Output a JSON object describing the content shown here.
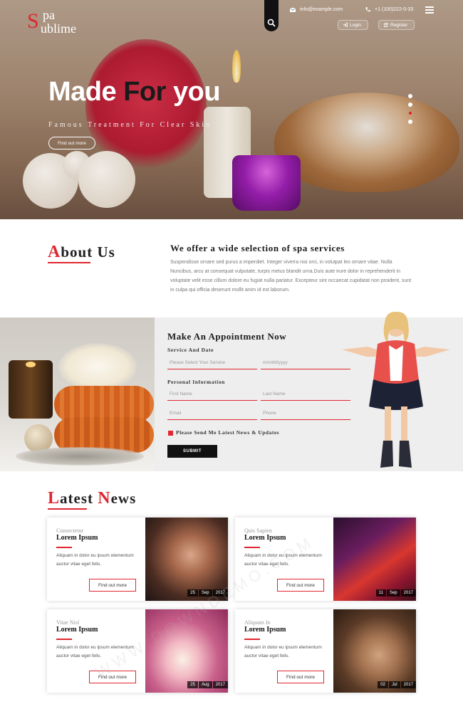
{
  "brand": {
    "logo_cap_s1": "S",
    "logo_line1": "pa",
    "logo_cap_s2": "S",
    "logo_line2": "ublime",
    "accent_color": "#e0262f"
  },
  "header": {
    "email": "info@example.com",
    "phone": "+1 (100)222-0-33",
    "login_label": "Login",
    "register_label": "Register",
    "search_icon": "search-icon",
    "menu_icon": "menu-icon"
  },
  "hero": {
    "title_part1": "Made ",
    "title_part2": "For",
    "title_part3": " you",
    "subtitle": "Famous Treatment For Clear Skin",
    "button_label": "Find out more",
    "slides_count": 4,
    "active_slide": 3
  },
  "about": {
    "title_first": "A",
    "title_rest": "bout Us",
    "heading": "We offer a wide selection of spa services",
    "text": "Suspendisse ornare sed purus a imperdiet. Integer viverra nisi orci, in volutpat leo ornare vitae. Nulla Nuncibus, arcu at consequat vulputate, turpis metus blandit urna.Duis aute irure dolor in reprehenderit in voluptate velit esse cillum dolore eu fugiat nulla pariatur. Excepteur sint occaecat cupidatat non proident, sunt in culpa qui officia deserunt mollit anim id est laborum."
  },
  "appointment": {
    "title": "Make An Appointment Now",
    "section1_label": "Service And Date",
    "service_placeholder": "Please Select Your Service",
    "date_placeholder": "mm/dd/yyyy",
    "section2_label": "Personal Information",
    "firstname_placeholder": "First Name",
    "lastname_placeholder": "Last Name",
    "email_placeholder": "Email",
    "phone_placeholder": "Phone",
    "newsletter_label": "Please Send Me Latest News & Updates",
    "submit_label": "SUBMIT"
  },
  "news": {
    "title_first": "L",
    "title_rest1": "atest ",
    "title_first2": "N",
    "title_rest2": "ews",
    "cards": [
      {
        "category": "Consectetur",
        "title": "Lorem Ipsum",
        "text": "Aliquam in dolor eu ipsum elementum auctor vitae eget felis.",
        "button": "Find out more",
        "day": "25",
        "month": "Sep",
        "year": "2017"
      },
      {
        "category": "Quis Sapien",
        "title": "Lorem Ipsum",
        "text": "Aliquam in dolor eu ipsum elementum auctor vitae eget felis.",
        "button": "Find out more",
        "day": "11",
        "month": "Sep",
        "year": "2017"
      },
      {
        "category": "Vitae Nisl",
        "title": "Lorem Ipsum",
        "text": "Aliquam in dolor eu ipsum elementum auctor vitae eget felis.",
        "button": "Find out more",
        "day": "25",
        "month": "Aug",
        "year": "2017"
      },
      {
        "category": "Aliquam In",
        "title": "Lorem Ipsum",
        "text": "Aliquam in dolor eu ipsum elementum auctor vitae eget felis.",
        "button": "Find out more",
        "day": "02",
        "month": "Jul",
        "year": "2017"
      }
    ]
  },
  "watermark": "WWW.DOWNDEMO.COM"
}
